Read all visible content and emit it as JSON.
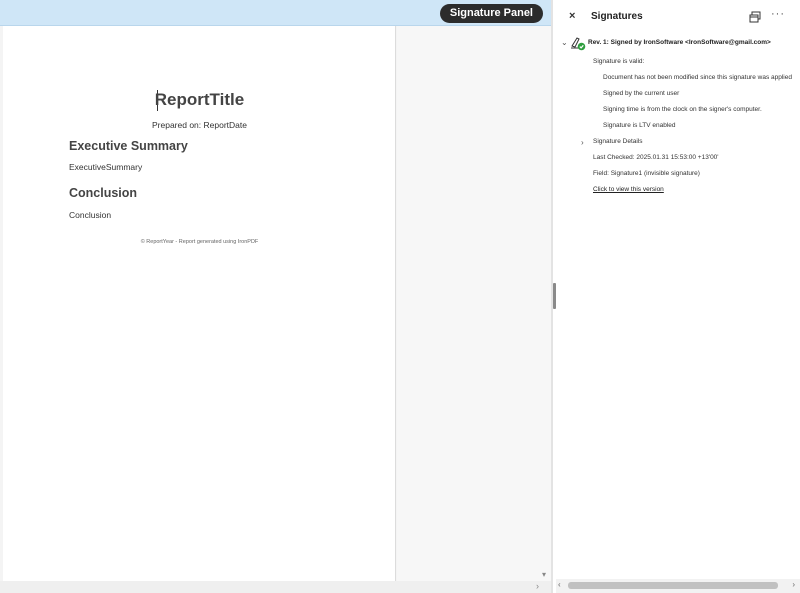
{
  "toolbar": {
    "signature_panel_button": "Signature Panel"
  },
  "document": {
    "title": "ReportTitle",
    "prepared_on": "Prepared on: ReportDate",
    "heading_summary": "Executive Summary",
    "summary_text": "ExecutiveSummary",
    "heading_conclusion": "Conclusion",
    "conclusion_text": "Conclusion",
    "footer": "© ReportYear - Report generated using IronPDF"
  },
  "panel": {
    "close": "×",
    "title": "Signatures",
    "more": "···",
    "revision": {
      "title": "Rev. 1: Signed by IronSoftware <IronSoftware@gmail.com>",
      "status": "Signature is valid:",
      "checks": [
        "Document has not been modified since this signature was applied",
        "Signed by the current user",
        "Signing time is from the clock on the signer's computer.",
        "Signature is LTV enabled"
      ],
      "details_label": "Signature Details",
      "last_checked": "Last Checked: 2025.01.31 15:53:00 +13'00'",
      "field": "Field: Signature1 (invisible signature)",
      "view_version_link": "Click to view this version"
    }
  },
  "colors": {
    "topbar": "#cfe6f7",
    "valid_badge": "#2e9e3e"
  },
  "icons": [
    "close-icon",
    "copy-window-icon",
    "more-options-icon",
    "chevron-down-icon",
    "signature-valid-icon",
    "chevron-right-icon"
  ]
}
